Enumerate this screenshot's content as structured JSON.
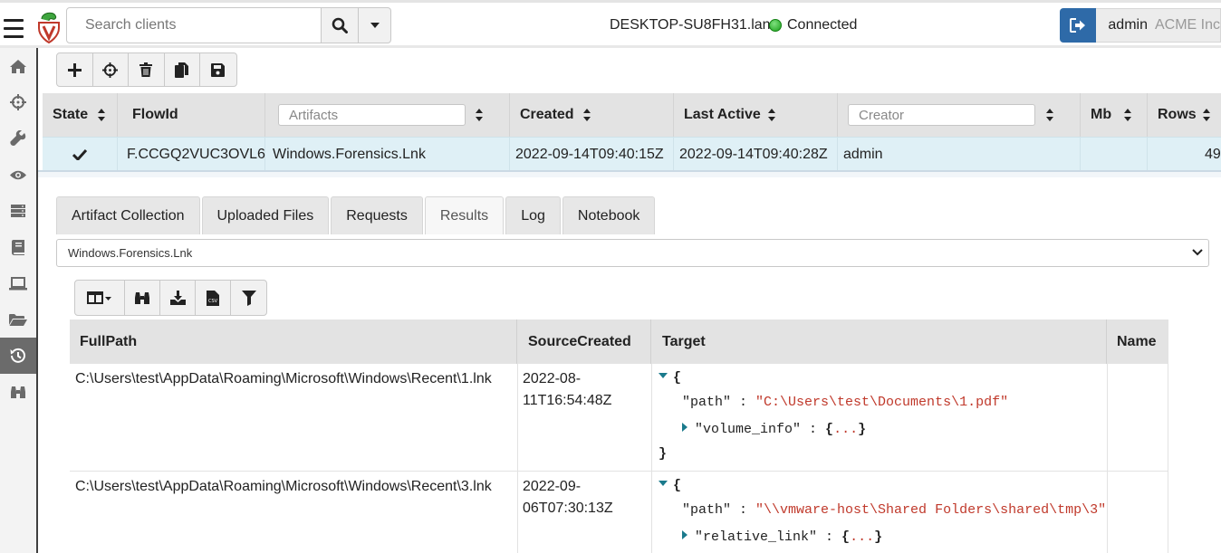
{
  "header": {
    "search_placeholder": "Search clients",
    "hostname": "DESKTOP-SU8FH31.lan",
    "connection_status": "Connected",
    "connection_color": "#19a019",
    "user": "admin",
    "org": "ACME Inc",
    "accent_color": "#2e6aa8"
  },
  "sidebar": {
    "items": [
      {
        "icon": "home-icon"
      },
      {
        "icon": "crosshairs-icon"
      },
      {
        "icon": "wrench-icon"
      },
      {
        "icon": "eye-icon"
      },
      {
        "icon": "server-icon"
      },
      {
        "icon": "book-icon"
      },
      {
        "icon": "laptop-icon"
      },
      {
        "icon": "folder-open-icon"
      },
      {
        "icon": "history-icon",
        "active": true
      },
      {
        "icon": "binoculars-icon"
      }
    ]
  },
  "toolbar": {
    "buttons": [
      "plus-icon",
      "crosshairs-icon",
      "trash-icon",
      "copy-icon",
      "save-icon"
    ]
  },
  "flows": {
    "columns": {
      "state": "State",
      "flow_id": "FlowId",
      "artifacts_placeholder": "Artifacts",
      "created": "Created",
      "last_active": "Last Active",
      "creator_placeholder": "Creator",
      "mb": "Mb",
      "rows": "Rows"
    },
    "rows": [
      {
        "state_icon": "check-icon",
        "flow_id": "F.CCGQ2VUC3OVL6",
        "artifacts": "Windows.Forensics.Lnk",
        "created": "2022-09-14T09:40:15Z",
        "last_active": "2022-09-14T09:40:28Z",
        "creator": "admin",
        "mb": "",
        "rows": "49"
      }
    ]
  },
  "tabs": [
    "Artifact Collection",
    "Uploaded Files",
    "Requests",
    "Results",
    "Log",
    "Notebook"
  ],
  "active_tab": "Results",
  "artifact_select": {
    "selected": "Windows.Forensics.Lnk"
  },
  "results_toolbar": {
    "buttons": [
      "columns-icon",
      "binoculars-icon",
      "download-icon",
      "csv-icon",
      "filter-icon"
    ]
  },
  "results": {
    "columns": [
      "FullPath",
      "SourceCreated",
      "Target",
      "Name"
    ],
    "rows": [
      {
        "full_path": "C:\\Users\\test\\AppData\\Roaming\\Microsoft\\Windows\\Recent\\1.lnk",
        "source_created_line1": "2022-08-",
        "source_created_line2": "11T16:54:48Z",
        "target": {
          "open": "{",
          "path_key": "\"path\"",
          "path_value": "\"C:\\Users\\test\\Documents\\1.pdf\"",
          "child_key": "\"volume_info\"",
          "child_open": "{",
          "child_ellipsis": "...",
          "child_close": "}",
          "close": "}"
        },
        "name": ""
      },
      {
        "full_path": "C:\\Users\\test\\AppData\\Roaming\\Microsoft\\Windows\\Recent\\3.lnk",
        "source_created_line1": "2022-09-",
        "source_created_line2": "06T07:30:13Z",
        "target": {
          "open": "{",
          "path_key": "\"path\"",
          "path_value": "\"\\\\vmware-host\\Shared Folders\\shared\\tmp\\3\"",
          "child_key": "\"relative_link\"",
          "child_open": "{",
          "child_ellipsis": "...",
          "child_close": "}"
        },
        "name": ""
      }
    ]
  }
}
